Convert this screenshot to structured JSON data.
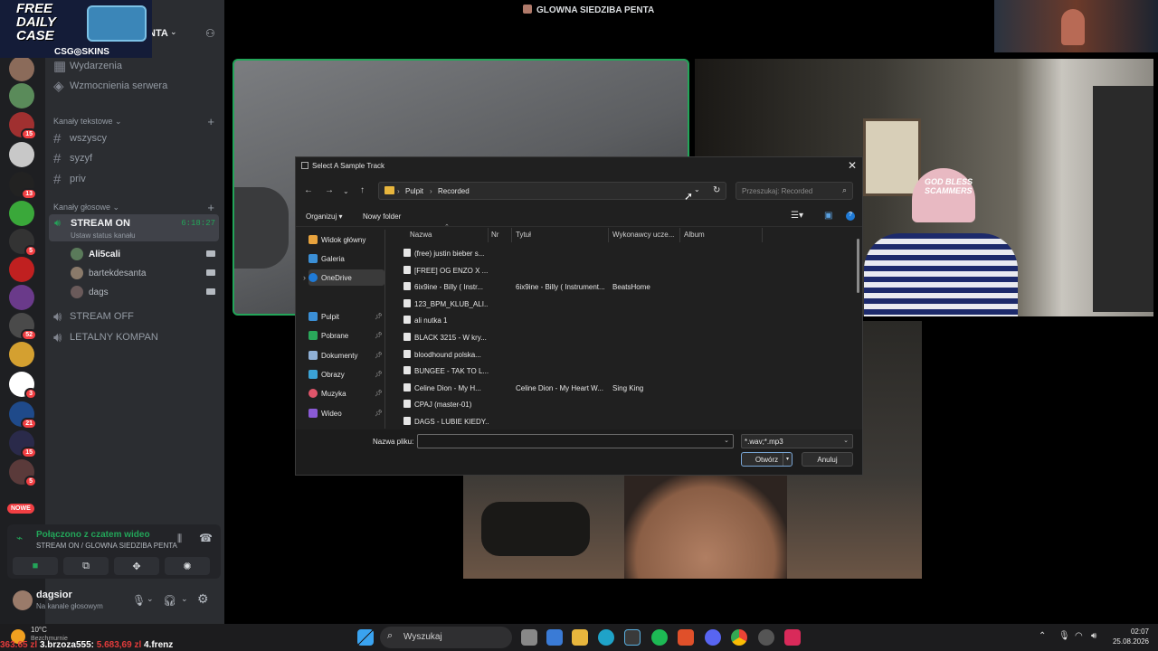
{
  "window": {
    "title": "GLOWNA SIEDZIBA PENTA"
  },
  "promo": {
    "line1": "FREE",
    "line2": "DAILY",
    "line3": "CASE",
    "brand": "CSG◎SKINS"
  },
  "server": {
    "name": "NTA"
  },
  "server_badges": [
    "15",
    "13",
    "5",
    "52",
    "3",
    "21",
    "15",
    "5"
  ],
  "new_label": "NOWE",
  "channels": {
    "top_items": [
      "Wydarzenia",
      "Wzmocnienia serwera"
    ],
    "text_category": "Kanały tekstowe",
    "text_channels": [
      "wszyscy",
      "syzyf",
      "priv"
    ],
    "voice_category": "Kanały głosowe",
    "active_voice": {
      "name": "STREAM ON",
      "status": "Ustaw status kanału",
      "time": "6:18:27"
    },
    "members": [
      "Ali5cali",
      "bartekdesanta",
      "dags"
    ],
    "other_voice": [
      "STREAM OFF",
      "LETALNY KOMPAN"
    ]
  },
  "voice_connection": {
    "title": "Połączono z czatem wideo",
    "subtitle": "STREAM ON / GLOWNA SIEDZIBA PENTA"
  },
  "user": {
    "name": "dagsior",
    "status": "Na kanale głosowym"
  },
  "video": {
    "hat_text": "GOD BLESS SCAMMERS"
  },
  "dialog": {
    "title": "Select A Sample Track",
    "breadcrumb": [
      "Pulpit",
      "Recorded"
    ],
    "search_placeholder": "Przeszukaj: Recorded",
    "toolbar": {
      "organize": "Organizuj",
      "new_folder": "Nowy folder"
    },
    "nav": [
      {
        "label": "Widok główny",
        "icon": "home-icon",
        "color": "#e8a33d"
      },
      {
        "label": "Galeria",
        "icon": "gallery-icon",
        "color": "#3b8fd6"
      },
      {
        "label": "OneDrive",
        "icon": "onedrive-icon",
        "color": "#1f7ad6"
      },
      {
        "label": "Pulpit",
        "icon": "desktop-icon",
        "color": "#3b8fd6"
      },
      {
        "label": "Pobrane",
        "icon": "download-icon",
        "color": "#2aa85a"
      },
      {
        "label": "Dokumenty",
        "icon": "documents-icon",
        "color": "#8fb0d6"
      },
      {
        "label": "Obrazy",
        "icon": "pictures-icon",
        "color": "#3ba3d6"
      },
      {
        "label": "Muzyka",
        "icon": "music-icon",
        "color": "#e0556a"
      },
      {
        "label": "Wideo",
        "icon": "video-icon",
        "color": "#8a5ad6"
      }
    ],
    "columns": [
      "Nazwa",
      "Nr",
      "Tytuł",
      "Wykonawcy ucze...",
      "Album"
    ],
    "files": [
      {
        "name": "(free) justin bieber s...",
        "title": "",
        "artist": ""
      },
      {
        "name": "[FREE] OG ENZO X ...",
        "title": "",
        "artist": ""
      },
      {
        "name": "6ix9ine - Billy ( Instr...",
        "title": "6ix9ine - Billy ( Instrument...",
        "artist": "BeatsHome"
      },
      {
        "name": "123_BPM_KLUB_ALI...",
        "title": "",
        "artist": ""
      },
      {
        "name": "ali nutka 1",
        "title": "",
        "artist": ""
      },
      {
        "name": "BLACK 3215 - W kry...",
        "title": "",
        "artist": ""
      },
      {
        "name": "bloodhound polska...",
        "title": "",
        "artist": ""
      },
      {
        "name": "BUNGEE - TAK TO L...",
        "title": "",
        "artist": ""
      },
      {
        "name": "Celine Dion - My H...",
        "title": "Celine Dion - My Heart W...",
        "artist": "Sing King"
      },
      {
        "name": "CPAJ (master-01)",
        "title": "",
        "artist": ""
      },
      {
        "name": "DAGS - LUBIE KIEDY...",
        "title": "",
        "artist": ""
      }
    ],
    "filename_label": "Nazwa pliku:",
    "filename_value": "",
    "filetype": "*.wav;*.mp3",
    "open": "Otwórz",
    "cancel": "Anuluj"
  },
  "taskbar": {
    "weather_temp": "10°C",
    "weather_desc": "Bezchmurnie",
    "search": "Wyszukaj",
    "time": "02:07",
    "date": "25.08.2026"
  },
  "overlay": {
    "p1": "3.brzoza555:",
    "p1v": "5.683,69 zl",
    "p2": "4.frenz",
    "prev": "363.65 zl"
  }
}
